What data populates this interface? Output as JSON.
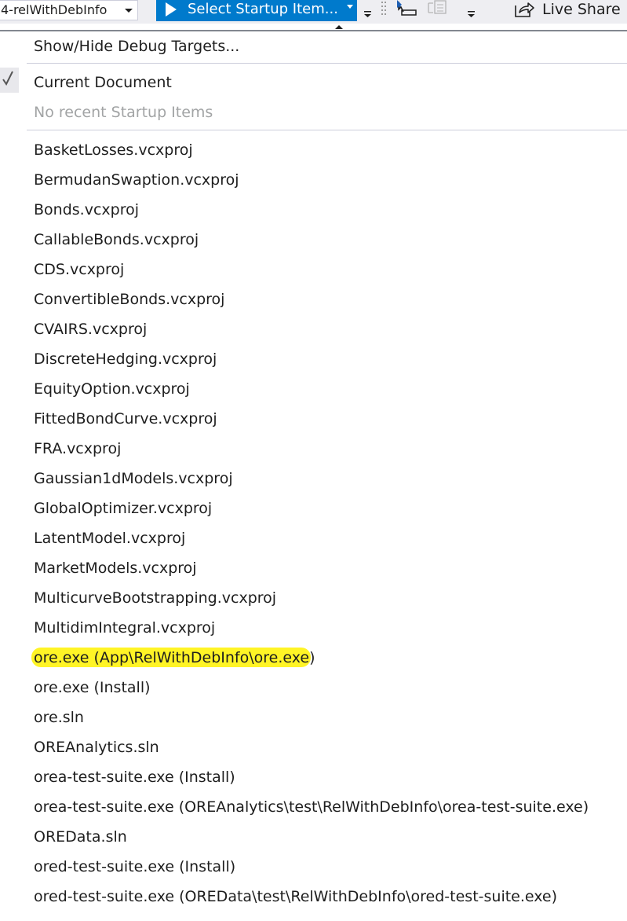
{
  "toolbar": {
    "config_value": "4-relWithDebInfo",
    "startup_button_label": "Select Startup Item...",
    "live_share_label": "Live Share",
    "accent_color": "#007acc"
  },
  "menu": {
    "show_hide_label": "Show/Hide Debug Targets...",
    "current_document_label": "Current Document",
    "current_document_checked": true,
    "no_recent_label": "No recent Startup Items",
    "highlight_color": "#fff200",
    "items": [
      "BasketLosses.vcxproj",
      "BermudanSwaption.vcxproj",
      "Bonds.vcxproj",
      "CallableBonds.vcxproj",
      "CDS.vcxproj",
      "ConvertibleBonds.vcxproj",
      "CVAIRS.vcxproj",
      "DiscreteHedging.vcxproj",
      "EquityOption.vcxproj",
      "FittedBondCurve.vcxproj",
      "FRA.vcxproj",
      "Gaussian1dModels.vcxproj",
      "GlobalOptimizer.vcxproj",
      "LatentModel.vcxproj",
      "MarketModels.vcxproj",
      "MulticurveBootstrapping.vcxproj",
      "MultidimIntegral.vcxproj",
      "ore.exe (App\\RelWithDebInfo\\ore.exe)",
      "ore.exe (Install)",
      "ore.sln",
      "OREAnalytics.sln",
      "orea-test-suite.exe (Install)",
      "orea-test-suite.exe (OREAnalytics\\test\\RelWithDebInfo\\orea-test-suite.exe)",
      "OREData.sln",
      "ored-test-suite.exe (Install)",
      "ored-test-suite.exe (OREData\\test\\RelWithDebInfo\\ored-test-suite.exe)"
    ]
  }
}
